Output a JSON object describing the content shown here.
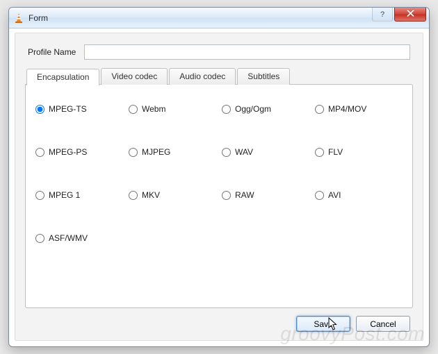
{
  "window": {
    "title": "Form"
  },
  "profile": {
    "label": "Profile Name",
    "value": ""
  },
  "tabs": {
    "items": [
      {
        "label": "Encapsulation"
      },
      {
        "label": "Video codec"
      },
      {
        "label": "Audio codec"
      },
      {
        "label": "Subtitles"
      }
    ],
    "active_index": 0
  },
  "encapsulation": {
    "options": [
      {
        "label": "MPEG-TS",
        "checked": true
      },
      {
        "label": "Webm",
        "checked": false
      },
      {
        "label": "Ogg/Ogm",
        "checked": false
      },
      {
        "label": "MP4/MOV",
        "checked": false
      },
      {
        "label": "MPEG-PS",
        "checked": false
      },
      {
        "label": "MJPEG",
        "checked": false
      },
      {
        "label": "WAV",
        "checked": false
      },
      {
        "label": "FLV",
        "checked": false
      },
      {
        "label": "MPEG 1",
        "checked": false
      },
      {
        "label": "MKV",
        "checked": false
      },
      {
        "label": "RAW",
        "checked": false
      },
      {
        "label": "AVI",
        "checked": false
      },
      {
        "label": "ASF/WMV",
        "checked": false
      }
    ]
  },
  "buttons": {
    "save": "Save",
    "cancel": "Cancel"
  },
  "watermark": "groovyPost.com"
}
